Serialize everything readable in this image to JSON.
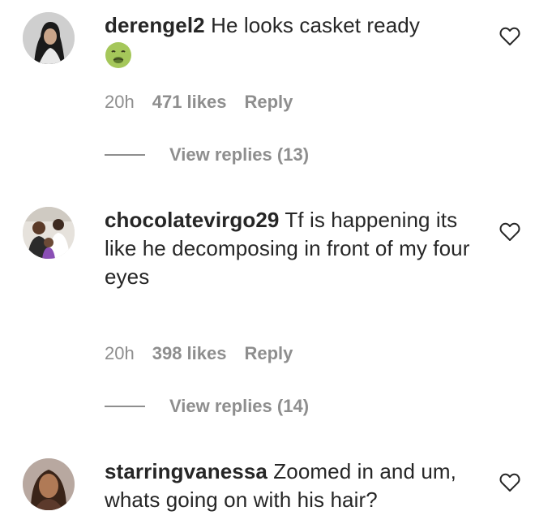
{
  "comments": [
    {
      "username": "derengel2",
      "text": "He looks casket ready",
      "emoji": "nauseated-face-emoji",
      "time": "20h",
      "likes": "471 likes",
      "reply": "Reply",
      "view_replies": "View replies (13)"
    },
    {
      "username": "chocolatevirgo29",
      "text": "Tf is happening its like he decomposing in front of my four eyes",
      "time": "20h",
      "likes": "398 likes",
      "reply": "Reply",
      "view_replies": "View replies (14)"
    },
    {
      "username": "starringvanessa",
      "text": "Zoomed in and um, whats going on with his hair?"
    }
  ],
  "icons": {
    "like": "heart-outline-icon"
  },
  "colors": {
    "text": "#262626",
    "secondary": "#8e8e8e",
    "emoji_face": "#a5c75a"
  }
}
